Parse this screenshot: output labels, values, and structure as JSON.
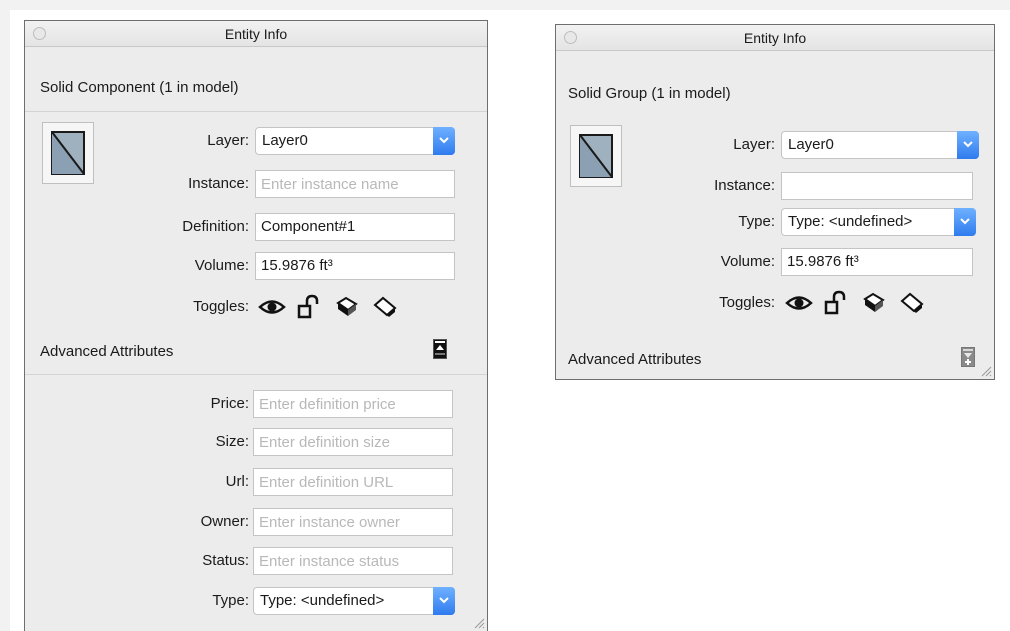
{
  "left_panel": {
    "window_title": "Entity Info",
    "entity_title": "Solid Component (1 in model)",
    "layer": {
      "label": "Layer:",
      "value": "Layer0"
    },
    "instance": {
      "label": "Instance:",
      "placeholder": "Enter instance name"
    },
    "definition": {
      "label": "Definition:",
      "value": "Component#1"
    },
    "volume": {
      "label": "Volume:",
      "value": "15.9876 ft³"
    },
    "toggles": {
      "label": "Toggles:",
      "icons": [
        "eye-icon",
        "unlock-icon",
        "receive-shadows-icon",
        "cast-shadows-icon"
      ]
    },
    "advanced": {
      "label": "Advanced Attributes",
      "expanded": true
    },
    "price": {
      "label": "Price:",
      "placeholder": "Enter definition price"
    },
    "size": {
      "label": "Size:",
      "placeholder": "Enter definition size"
    },
    "url": {
      "label": "Url:",
      "placeholder": "Enter definition URL"
    },
    "owner": {
      "label": "Owner:",
      "placeholder": "Enter instance owner"
    },
    "status": {
      "label": "Status:",
      "placeholder": "Enter instance status"
    },
    "type": {
      "label": "Type:",
      "value": "Type: <undefined>"
    }
  },
  "right_panel": {
    "window_title": "Entity Info",
    "entity_title": "Solid Group (1 in model)",
    "layer": {
      "label": "Layer:",
      "value": "Layer0"
    },
    "instance": {
      "label": "Instance:",
      "value": ""
    },
    "type": {
      "label": "Type:",
      "value": "Type: <undefined>"
    },
    "volume": {
      "label": "Volume:",
      "value": "15.9876 ft³"
    },
    "toggles": {
      "label": "Toggles:",
      "icons": [
        "eye-icon",
        "unlock-icon",
        "receive-shadows-icon",
        "cast-shadows-icon"
      ]
    },
    "advanced": {
      "label": "Advanced Attributes",
      "expanded": false
    }
  },
  "colors": {
    "panel_bg": "#ececec",
    "accent_blue": "#2f7bef",
    "placeholder": "#b8b8b8"
  }
}
